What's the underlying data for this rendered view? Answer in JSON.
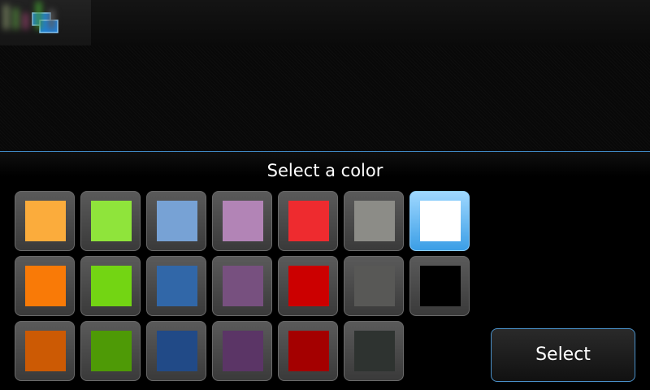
{
  "dialog": {
    "title": "Select a color",
    "select_label": "Select"
  },
  "selected_color": "#ffffff",
  "swatches": [
    [
      "#fbac3c",
      "#8fe43b",
      "#77a2d5",
      "#b284b6",
      "#ee2b2f",
      "#8c8c87",
      "#ffffff"
    ],
    [
      "#f97a07",
      "#73d513",
      "#3167a8",
      "#77507f",
      "#cc0000",
      "#585856",
      "#000000"
    ],
    [
      "#cc5a04",
      "#4e9a06",
      "#214a87",
      "#5b3566",
      "#a40000",
      "#2e3330"
    ]
  ],
  "icons": {
    "task_switcher": "task-switcher-icon"
  },
  "accent_color": "#3f89c4"
}
